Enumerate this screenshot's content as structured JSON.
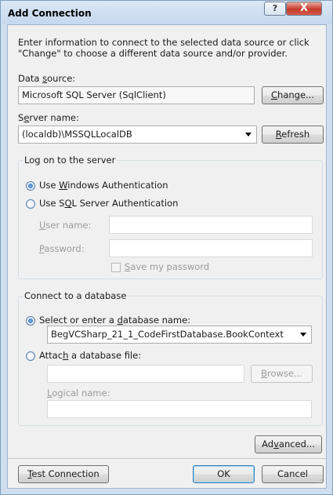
{
  "window": {
    "title": "Add Connection",
    "help_button": "?",
    "close_button": "X"
  },
  "intro": {
    "line1": "Enter information to connect to the selected data source or click",
    "line2": "\"Change\" to choose a different data source and/or provider."
  },
  "data_source": {
    "label_pre": "Data ",
    "label_key": "s",
    "label_post": "ource:",
    "value": "Microsoft SQL Server (SqlClient)"
  },
  "change_button": {
    "pre": "",
    "key": "C",
    "post": "hange..."
  },
  "server_name": {
    "label_pre": "S",
    "label_key": "e",
    "label_post": "rver name:",
    "value": "(localdb)\\MSSQLLocalDB"
  },
  "refresh_button": {
    "pre": "",
    "key": "R",
    "post": "efresh"
  },
  "logon_group": {
    "legend": "Log on to the server",
    "windows_auth": {
      "pre": "Use ",
      "key": "W",
      "post": "indows Authentication"
    },
    "sql_auth": {
      "pre": "Use S",
      "key": "Q",
      "post": "L Server Authentication"
    },
    "user_name": {
      "pre": "",
      "key": "U",
      "post": "ser name:",
      "value": ""
    },
    "password": {
      "pre": "",
      "key": "P",
      "post": "assword:",
      "value": ""
    },
    "save_password": {
      "pre": "",
      "key": "S",
      "post": "ave my password"
    },
    "selected": "windows"
  },
  "db_group": {
    "legend": "Connect to a database",
    "select_db": {
      "pre": "Select or enter a ",
      "key": "d",
      "post": "atabase name:"
    },
    "db_value": "BegVCSharp_21_1_CodeFirstDatabase.BookContext",
    "attach_db": {
      "pre": "Attac",
      "key": "h",
      "post": " a database file:"
    },
    "attach_value": "",
    "browse_button": {
      "pre": "",
      "key": "B",
      "post": "rowse..."
    },
    "logical_name": {
      "pre": "",
      "key": "L",
      "post": "ogical name:",
      "value": ""
    },
    "selected": "select"
  },
  "advanced_button": {
    "pre": "Ad",
    "key": "v",
    "post": "anced..."
  },
  "test_button": {
    "pre": "",
    "key": "T",
    "post": "est Connection"
  },
  "ok_button": "OK",
  "cancel_button": "Cancel"
}
